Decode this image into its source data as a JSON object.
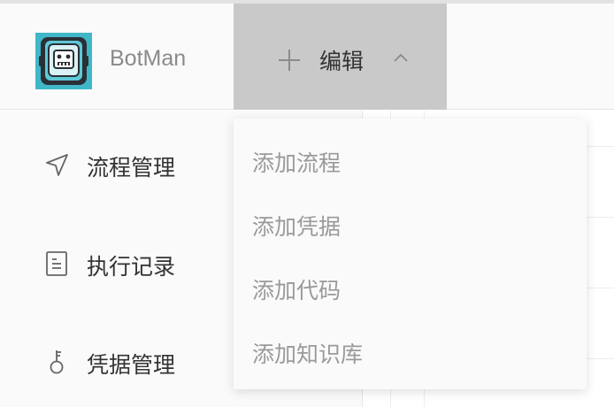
{
  "header": {
    "brand": "BotMan",
    "edit_label": "编辑",
    "logo_icon": "robot-logo-icon",
    "plus_icon": "plus-icon",
    "chevron_icon": "chevron-up-icon"
  },
  "sidebar": {
    "items": [
      {
        "label": "流程管理",
        "icon": "navigation-arrow-icon"
      },
      {
        "label": "执行记录",
        "icon": "document-icon"
      },
      {
        "label": "凭据管理",
        "icon": "key-icon"
      }
    ]
  },
  "dropdown": {
    "items": [
      {
        "label": "添加流程"
      },
      {
        "label": "添加凭据"
      },
      {
        "label": "添加代码"
      },
      {
        "label": "添加知识库"
      }
    ]
  },
  "colors": {
    "header_bg": "#fafafa",
    "edit_button_bg": "#c9c9c9",
    "dropdown_text": "#9a9a9a",
    "logo_teal": "#36b7c9"
  }
}
